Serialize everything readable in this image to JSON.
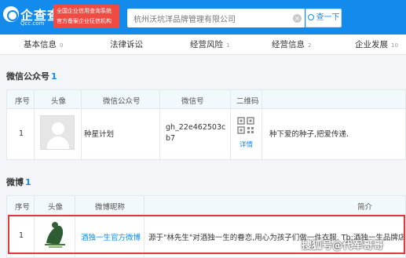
{
  "header": {
    "logo_text": "企查查",
    "logo_sub": "Qcc.com",
    "badge_line1": "全国企业信用查询系统",
    "badge_line2": "官方备案企业征信机构",
    "search_value": "杭州沃坑洋品牌管理有限公司",
    "search_button": "查一下",
    "brand_color": "#128bed"
  },
  "tabs": [
    {
      "label": "基本信息",
      "count": "0"
    },
    {
      "label": "法律诉讼",
      "count": ""
    },
    {
      "label": "经营风险",
      "count": "1"
    },
    {
      "label": "经营信息",
      "count": "2"
    },
    {
      "label": "企业发展",
      "count": "10"
    }
  ],
  "wechat": {
    "title": "微信公众号",
    "count": "1",
    "columns": [
      "序号",
      "头像",
      "微信公众号",
      "微信号",
      "二维码"
    ],
    "rows": [
      {
        "index": "1",
        "name": "种星计划",
        "id_line1": "gh_22e462503c",
        "id_line2": "b7",
        "qr_label": "详情",
        "desc": "种下爱的种子,把爱传递."
      }
    ]
  },
  "weibo": {
    "title": "微博",
    "count": "1",
    "columns": [
      "序号",
      "头像",
      "微博昵称",
      "简介"
    ],
    "rows": [
      {
        "index": "1",
        "name": "酒独一生官方微博",
        "desc": "源于\"林先生\"对酒独一生的眷恋,用心为孩子们做一件衣服. Tb:酒独一生品牌店"
      }
    ]
  },
  "watermark": "搜狐号@代军哥哥"
}
